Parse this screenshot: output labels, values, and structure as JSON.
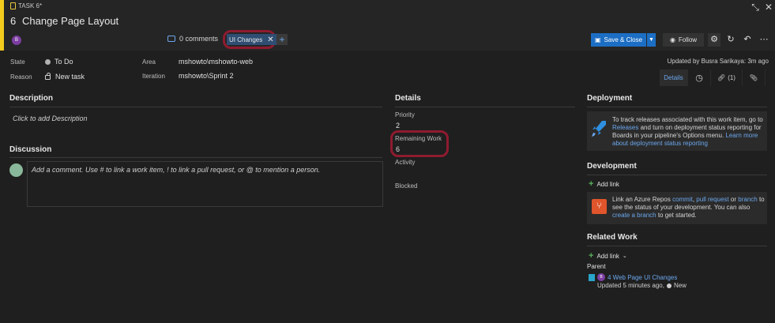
{
  "header": {
    "type_label": "TASK 6*",
    "id": "6",
    "title": "Change Page Layout",
    "assigned_initial": "B",
    "comments_label": "0 comments",
    "tag": "UI Changes",
    "tag_add": "+",
    "save_label": "Save & Close",
    "follow_label": "Follow"
  },
  "fields": {
    "state_label": "State",
    "state_value": "To Do",
    "reason_label": "Reason",
    "reason_value": "New task",
    "area_label": "Area",
    "area_value": "mshowto\\mshowto-web",
    "iteration_label": "Iteration",
    "iteration_value": "mshowto\\Sprint 2",
    "updated": "Updated by Busra Sarikaya: 3m ago"
  },
  "tabs": {
    "details": "Details",
    "links_count": "(1)"
  },
  "description": {
    "title": "Description",
    "placeholder": "Click to add Description"
  },
  "discussion": {
    "title": "Discussion",
    "placeholder": "Add a comment. Use # to link a work item, ! to link a pull request, or @ to mention a person."
  },
  "details": {
    "title": "Details",
    "priority_label": "Priority",
    "priority_value": "2",
    "remaining_label": "Remaining Work",
    "remaining_value": "6",
    "activity_label": "Activity",
    "blocked_label": "Blocked"
  },
  "deployment": {
    "title": "Deployment",
    "text1": "To track releases associated with this work item, go to",
    "link_releases": "Releases",
    "text2": "and turn on deployment status reporting for",
    "text3": "Boards in your pipeline's Options menu.",
    "link_learn": "Learn more",
    "link_about": "about deployment status reporting"
  },
  "development": {
    "title": "Development",
    "add_link": "Add link",
    "text1": "Link an Azure Repos",
    "link_commit": "commit",
    "link_pr": "pull request",
    "text_or": "or",
    "link_branch": "branch",
    "text_to": "to",
    "text2": "see the status of your development. You can also",
    "link_create": "create a branch",
    "text3": "to get started."
  },
  "related": {
    "title": "Related Work",
    "add_link": "Add link",
    "parent_label": "Parent",
    "parent_initial": "B",
    "parent_item": "4 Web Page UI Changes",
    "parent_meta": "Updated 5 minutes ago,",
    "parent_state": "New"
  }
}
